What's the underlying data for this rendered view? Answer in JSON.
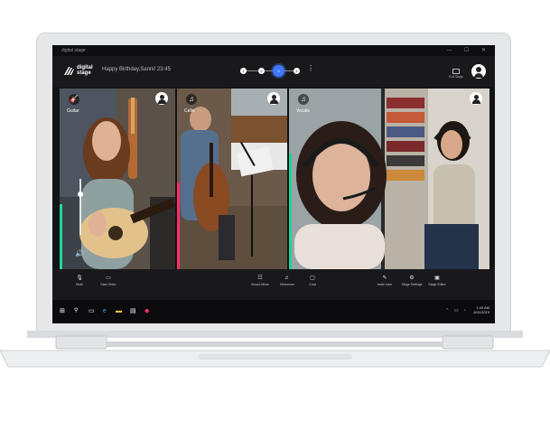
{
  "window": {
    "title": "digital stage",
    "controls": "— ☐ ✕"
  },
  "header": {
    "brand": "digital\nstage",
    "stage_name": "Happy Birthday,Sanni! 23:45",
    "steps": [
      "1",
      "2",
      "3",
      "4"
    ],
    "active_step": 3,
    "menu_glyph": "⋮",
    "exit_stage_label": "Exit Stage"
  },
  "tiles": [
    {
      "label": "Guitar",
      "icon": "guitar-icon",
      "accent": "#1ed69a",
      "volume": 0.75
    },
    {
      "label": "Cello",
      "icon": "music-note-icon",
      "accent": "#ff2f6b"
    },
    {
      "label": "Vocals",
      "icon": "music-note-icon",
      "accent": "#1ed69a"
    }
  ],
  "toolbar": {
    "left": [
      {
        "label": "Mute",
        "icon": "microphone-icon"
      },
      {
        "label": "Start Video",
        "icon": "video-camera-icon"
      }
    ],
    "center": [
      {
        "label": "Sound Mixer",
        "icon": "mixer-icon"
      },
      {
        "label": "Metronom",
        "icon": "metronome-icon"
      },
      {
        "label": "Chat",
        "icon": "chat-icon"
      }
    ],
    "right": [
      {
        "label": "Invite User",
        "icon": "invite-user-icon"
      },
      {
        "label": "Stage Settings",
        "icon": "stage-settings-icon"
      },
      {
        "label": "Stage Editor",
        "icon": "stage-editor-icon"
      }
    ]
  },
  "taskbar": {
    "time": "1:40 AM",
    "date": "8/11/2019"
  },
  "colors": {
    "accent_blue": "#3f78ff",
    "accent_green": "#1ed69a",
    "accent_pink": "#ff2f6b",
    "chrome": "#e6e7e9"
  }
}
